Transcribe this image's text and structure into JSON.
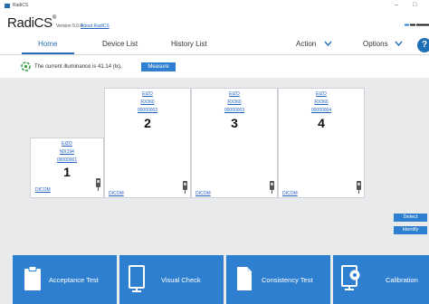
{
  "window": {
    "title": "RadiCS",
    "controls": [
      "–",
      "□"
    ]
  },
  "brand": {
    "logo": "RadiCS",
    "trademark": "®",
    "version": "Version 5.0.0",
    "about_link": "About RadiCS"
  },
  "nav": {
    "tabs": [
      {
        "label": "Home",
        "active": true
      },
      {
        "label": "Device List",
        "active": false
      },
      {
        "label": "History List",
        "active": false
      }
    ],
    "action_menu": "Action",
    "options_menu": "Options",
    "help_label": "?"
  },
  "illuminance": {
    "text": "The current illuminance is 41.14 (lx).",
    "measure_button": "Measure"
  },
  "monitors": [
    {
      "manufacturer": "EIZO",
      "model": "MX194",
      "serial": "00000001",
      "number": "1",
      "dicom": "DICOM"
    },
    {
      "manufacturer": "EIZO",
      "model": "RX360",
      "serial": "00000002",
      "number": "2",
      "dicom": "DICOM"
    },
    {
      "manufacturer": "EIZO",
      "model": "RX360",
      "serial": "00000003",
      "number": "3",
      "dicom": "DICOM"
    },
    {
      "manufacturer": "EIZO",
      "model": "RX360",
      "serial": "00000004",
      "number": "4",
      "dicom": "DICOM"
    }
  ],
  "side_buttons": {
    "detect": "Detect",
    "identify": "Identify"
  },
  "actions": [
    {
      "label": "Acceptance Test",
      "icon": "clipboard-icon"
    },
    {
      "label": "Visual Check",
      "icon": "monitor-icon"
    },
    {
      "label": "Consistency Test",
      "icon": "document-icon"
    },
    {
      "label": "Calibration",
      "icon": "calibration-sensor-icon"
    }
  ],
  "colors": {
    "accent": "#2f7fd0",
    "tab_active": "#2a6db5",
    "link": "#2060c0",
    "workarea": "#e8eaec"
  }
}
